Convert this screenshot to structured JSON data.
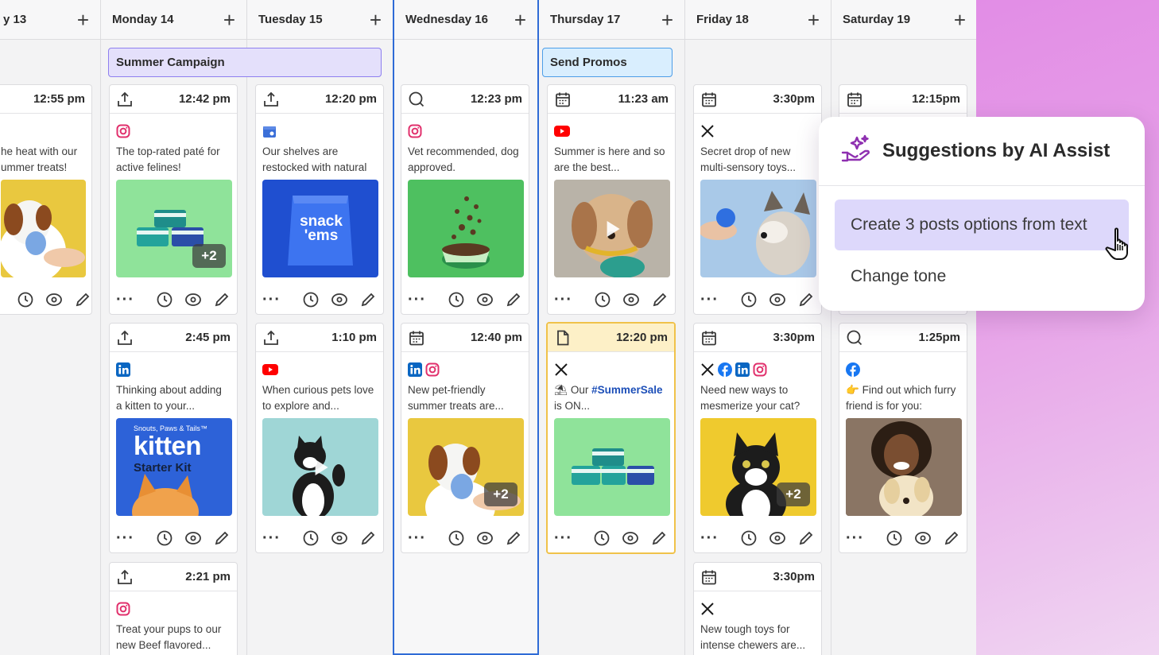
{
  "days": [
    {
      "label": "y 13"
    },
    {
      "label": "Monday 14"
    },
    {
      "label": "Tuesday 15"
    },
    {
      "label": "Wednesday 16"
    },
    {
      "label": "Thursday 17"
    },
    {
      "label": "Friday 18"
    },
    {
      "label": "Saturday 19"
    }
  ],
  "add_label": "+",
  "campaigns": {
    "summer": "Summer Campaign",
    "promos": "Send Promos"
  },
  "posts": {
    "sun1": {
      "time": "12:55 pm",
      "text": "he heat with our ummer treats!"
    },
    "mon1": {
      "time": "12:42 pm",
      "text": "The top-rated paté for active felines!",
      "badge": "+2"
    },
    "mon2": {
      "time": "2:45 pm",
      "text": "Thinking about adding a kitten to your...",
      "img_title_top": "Snouts, Paws & Tails™",
      "img_title": "kitten",
      "img_sub": "Starter Kit"
    },
    "mon3": {
      "time": "2:21 pm",
      "text": "Treat your pups to our new Beef flavored..."
    },
    "tue1": {
      "time": "12:20 pm",
      "text": "Our shelves are restocked with natural",
      "img_label": "snack 'ems"
    },
    "tue2": {
      "time": "1:10 pm",
      "text": "When curious pets love to explore and..."
    },
    "wed1": {
      "time": "12:23 pm",
      "text": "Vet recommended, dog approved."
    },
    "wed2": {
      "time": "12:40 pm",
      "text": "New pet-friendly summer treats are...",
      "badge": "+2"
    },
    "thu1": {
      "time": "11:23 am",
      "text": "Summer is here and so are the best..."
    },
    "thu2": {
      "time": "12:20 pm",
      "text_pre": "Our ",
      "hashtag": "#SummerSale",
      "text_post": "is ON..."
    },
    "fri1": {
      "time": "3:30pm",
      "text": "Secret drop of new multi-sensory toys..."
    },
    "fri2": {
      "time": "3:30pm",
      "text": "Need new ways to mesmerize your cat?",
      "badge": "+2"
    },
    "fri3": {
      "time": "3:30pm",
      "text": "New tough toys for intense chewers are..."
    },
    "sat1": {
      "time": "12:15pm"
    },
    "sat2": {
      "time": "1:25pm",
      "text": "Find out which furry friend is for you:"
    }
  },
  "actions": {
    "more": "···"
  },
  "popup": {
    "title": "Suggestions by AI Assist",
    "options": [
      "Create 3 posts options from text",
      "Change tone"
    ]
  },
  "colors": {
    "accent_blue": "#2f6bd6",
    "selected_option": "#ddd8fb",
    "draft_yellow": "#f0c24a",
    "gradient_pink": "#e28de6"
  }
}
